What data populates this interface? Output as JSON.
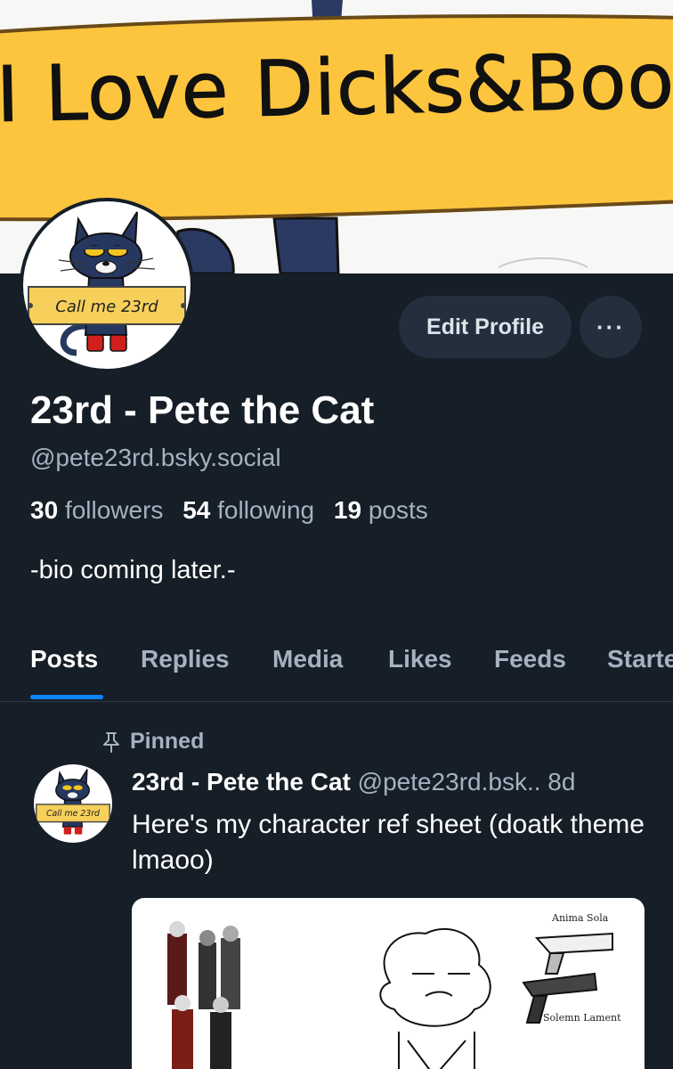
{
  "banner": {
    "text": "I Love Dicks&Boobies"
  },
  "avatar": {
    "sign_text": "Call me 23rd",
    "alt": "Pete the Cat avatar"
  },
  "actions": {
    "edit_profile": "Edit Profile",
    "more": "···"
  },
  "profile": {
    "display_name": "23rd - Pete the Cat",
    "handle": "@pete23rd.bsky.social",
    "stats": {
      "followers_count": "30",
      "followers_label": "followers",
      "following_count": "54",
      "following_label": "following",
      "posts_count": "19",
      "posts_label": "posts"
    },
    "bio": "-bio coming later.-"
  },
  "tabs": [
    {
      "label": "Posts",
      "active": true
    },
    {
      "label": "Replies"
    },
    {
      "label": "Media"
    },
    {
      "label": "Likes"
    },
    {
      "label": "Feeds"
    },
    {
      "label": "Starter Packs"
    }
  ],
  "post": {
    "pinned_label": "Pinned",
    "pinned_icon": "pin-icon",
    "author": "23rd - Pete the Cat",
    "handle": "@pete23rd.bsk..",
    "time": "8d",
    "text": "Here's my character ref sheet (doatk theme lmaoo)",
    "image_labels": {
      "top": "Anima Sola",
      "bottom": "Solemn Lament"
    }
  },
  "colors": {
    "background": "#161e27",
    "button_bg": "#232f3d",
    "muted_text": "#a4b2c1",
    "accent": "#1083fe",
    "banner_band": "#fdc53e"
  }
}
